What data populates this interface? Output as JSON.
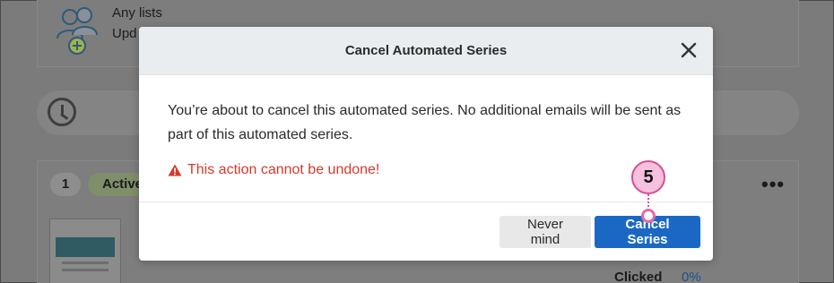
{
  "background": {
    "list_label": "Any lists",
    "updated_label": "Upd",
    "count": "1",
    "status": "Active",
    "more_label": "•••",
    "clicked_label": "Clicked",
    "clicked_value": "0%"
  },
  "modal": {
    "title": "Cancel Automated Series",
    "message": "You’re about to cancel this automated series. No additional emails will be sent as part of this automated series.",
    "warning": "This action cannot be undone!",
    "secondary_button": "Never mind",
    "primary_button": "Cancel Series"
  },
  "callout": {
    "step": "5"
  },
  "colors": {
    "primary": "#1b68c4",
    "warning": "#d33a2c",
    "callout_fill": "#f6c1dc",
    "callout_border": "#d94d96"
  }
}
